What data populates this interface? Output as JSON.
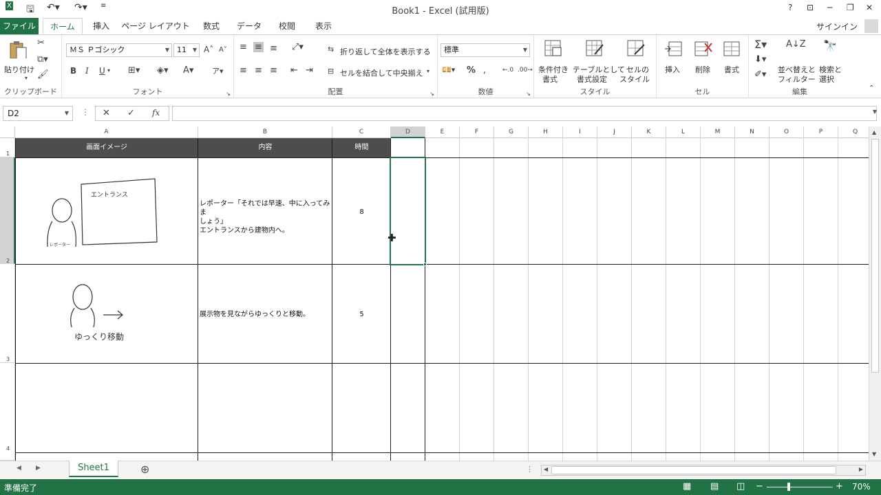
{
  "window": {
    "title": "Book1 - Excel (試用版)",
    "help": "?",
    "signin": "サインイン"
  },
  "tabs": {
    "file": "ファイル",
    "home": "ホーム",
    "insert": "挿入",
    "page_layout": "ページ レイアウト",
    "formulas": "数式",
    "data": "データ",
    "review": "校閲",
    "view": "表示"
  },
  "ribbon": {
    "clipboard": {
      "paste": "貼り付け",
      "label": "クリップボード"
    },
    "font": {
      "name": "ＭＳ Ｐゴシック",
      "size": "11",
      "bold": "B",
      "italic": "I",
      "underline": "U",
      "label": "フォント"
    },
    "alignment": {
      "wrap": "折り返して全体を表示する",
      "merge": "セルを結合して中央揃え",
      "label": "配置"
    },
    "number": {
      "format": "標準",
      "percent": "%",
      "label": "数値"
    },
    "styles": {
      "cond1": "条件付き",
      "cond2": "書式",
      "table1": "テーブルとして",
      "table2": "書式設定",
      "cell1": "セルの",
      "cell2": "スタイル",
      "label": "スタイル"
    },
    "cells": {
      "insert": "挿入",
      "delete": "削除",
      "format": "書式",
      "label": "セル"
    },
    "editing": {
      "sort1": "並べ替えと",
      "sort2": "フィルター",
      "find1": "検索と",
      "find2": "選択",
      "label": "編集"
    }
  },
  "formula_bar": {
    "name_box": "D2",
    "formula": "",
    "fx": "fx"
  },
  "columns": [
    "A",
    "B",
    "C",
    "D",
    "E",
    "F",
    "G",
    "H",
    "I",
    "J",
    "K",
    "L",
    "M",
    "N",
    "O",
    "P",
    "Q"
  ],
  "rows": [
    "1",
    "2",
    "3",
    "4"
  ],
  "table": {
    "headers": [
      "画面イメージ",
      "内容",
      "時間"
    ],
    "rows": [
      {
        "text_line1": "レポーター「それでは早速、中に入ってみま",
        "text_line2": "しょう」",
        "text_line3": "エントランスから建物内へ。",
        "time": "8",
        "sketch_label1": "エントランス",
        "sketch_label2": "レポーター"
      },
      {
        "text_line1": "展示物を見ながらゆっくりと移動。",
        "time": "5",
        "sketch_label1": "ゆっくり移動"
      }
    ]
  },
  "sheet": {
    "tab": "Sheet1"
  },
  "status": {
    "text": "準備完了",
    "zoom": "70%"
  }
}
